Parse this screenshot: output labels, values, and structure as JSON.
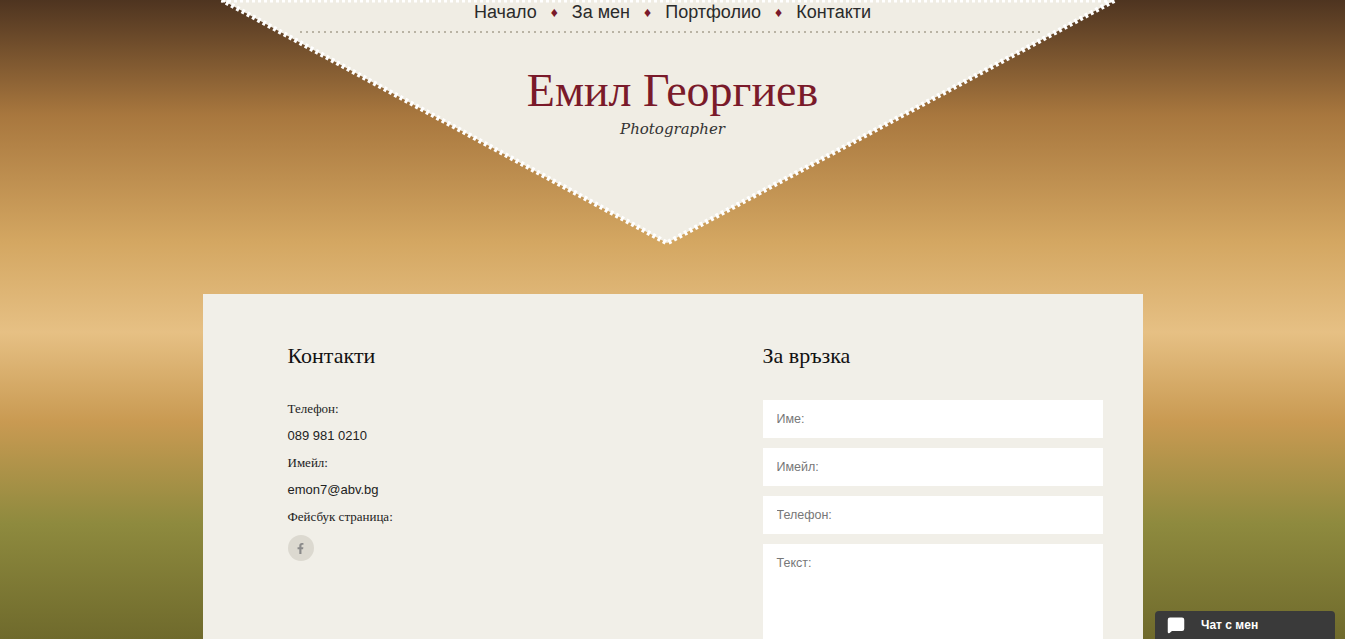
{
  "nav": {
    "items": [
      {
        "label": "Начало"
      },
      {
        "label": "За мен"
      },
      {
        "label": "Портфолио"
      },
      {
        "label": "Контакти"
      }
    ],
    "separator": "♦"
  },
  "header": {
    "title": "Емил Георгиев",
    "subtitle": "Photographer"
  },
  "contacts": {
    "heading": "Контакти",
    "rows": [
      {
        "label": "Телефон:",
        "value": "089 981 0210"
      },
      {
        "label": "Имейл:",
        "value": "emon7@abv.bg"
      }
    ],
    "facebook_label": "Фейсбук страница:"
  },
  "form": {
    "heading": "За връзка",
    "fields": [
      {
        "placeholder": "Име:",
        "kind": "input"
      },
      {
        "placeholder": "Имейл:",
        "kind": "input"
      },
      {
        "placeholder": "Телефон:",
        "kind": "input"
      },
      {
        "placeholder": "Текст:",
        "kind": "textarea"
      }
    ]
  },
  "chat": {
    "label": "Чат с мен"
  }
}
